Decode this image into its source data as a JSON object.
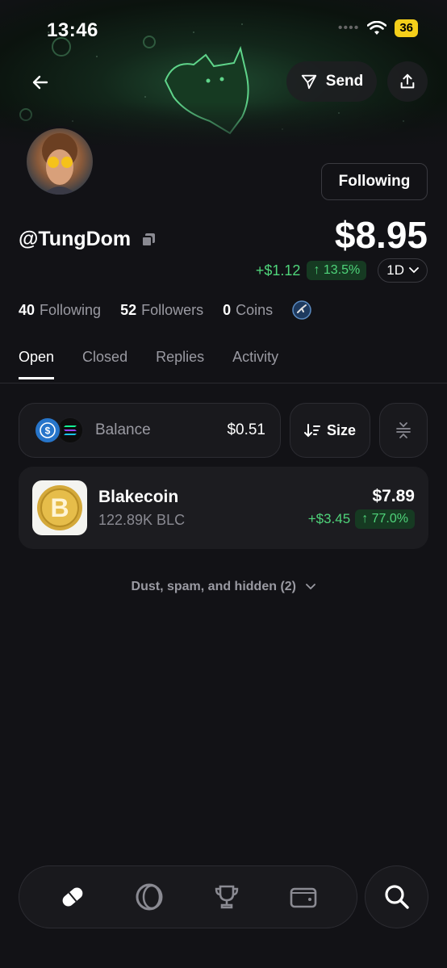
{
  "status": {
    "time": "13:46",
    "battery": "36"
  },
  "header": {
    "send_label": "Send"
  },
  "profile": {
    "follow_label": "Following",
    "username": "@TungDom",
    "portfolio_value": "$8.95",
    "change_amount": "+$1.12",
    "change_pct": "↑ 13.5%",
    "range": "1D"
  },
  "stats": {
    "following_count": "40",
    "following_label": "Following",
    "followers_count": "52",
    "followers_label": "Followers",
    "coins_count": "0",
    "coins_label": "Coins"
  },
  "tabs": [
    {
      "label": "Open"
    },
    {
      "label": "Closed"
    },
    {
      "label": "Replies"
    },
    {
      "label": "Activity"
    }
  ],
  "filters": {
    "balance_label": "Balance",
    "balance_value": "$0.51",
    "size_label": "Size"
  },
  "holdings": [
    {
      "name": "Blakecoin",
      "amount": "122.89K BLC",
      "value": "$7.89",
      "change": "+$3.45",
      "change_pct": "↑ 77.0%"
    }
  ],
  "dust_label": "Dust, spam, and hidden (2)",
  "colors": {
    "positive": "#4fd47a",
    "background": "#121216",
    "card": "#1c1c20"
  },
  "icons": [
    "back-arrow-icon",
    "send-icon",
    "share-icon",
    "copy-icon",
    "chevron-down-icon",
    "sort-icon",
    "collapse-icon",
    "pill-icon",
    "circle-icon",
    "trophy-icon",
    "wallet-icon",
    "search-icon"
  ]
}
